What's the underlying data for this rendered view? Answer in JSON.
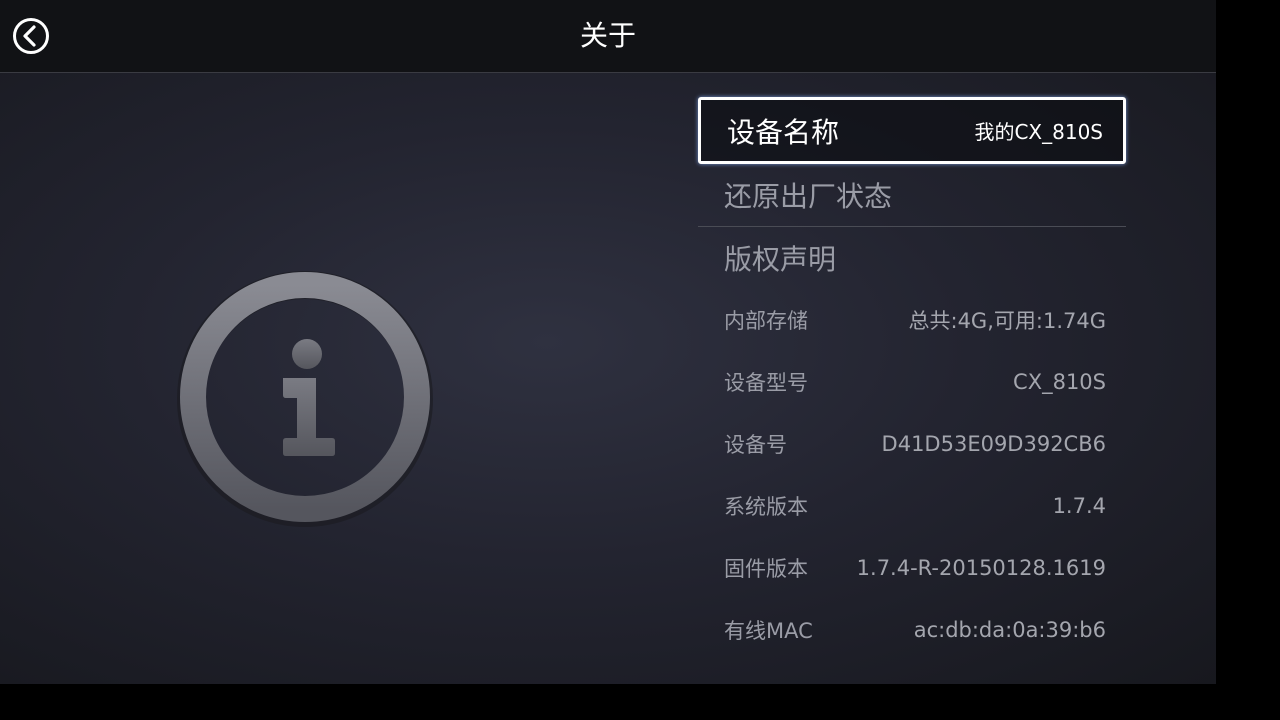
{
  "header": {
    "title": "关于",
    "back_icon": "back-arrow-circle-icon"
  },
  "graphic": {
    "icon": "info-circle-icon"
  },
  "menu": {
    "device_name": {
      "label": "设备名称",
      "value": "我的CX_810S"
    },
    "factory_reset": {
      "label": "还原出厂状态"
    },
    "copyright": {
      "label": "版权声明"
    }
  },
  "info": [
    {
      "label": "内部存储",
      "value": "总共:4G,可用:1.74G"
    },
    {
      "label": "设备型号",
      "value": "CX_810S"
    },
    {
      "label": "设备号",
      "value": "D41D53E09D392CB6"
    },
    {
      "label": "系统版本",
      "value": "1.7.4"
    },
    {
      "label": "固件版本",
      "value": "1.7.4-R-20150128.1619"
    },
    {
      "label": "有线MAC",
      "value": "ac:db:da:0a:39:b6"
    }
  ],
  "colors": {
    "background": "#232430",
    "header": "#111215",
    "selected_border": "#ffffff",
    "text_dim": "#9a9ca6"
  }
}
